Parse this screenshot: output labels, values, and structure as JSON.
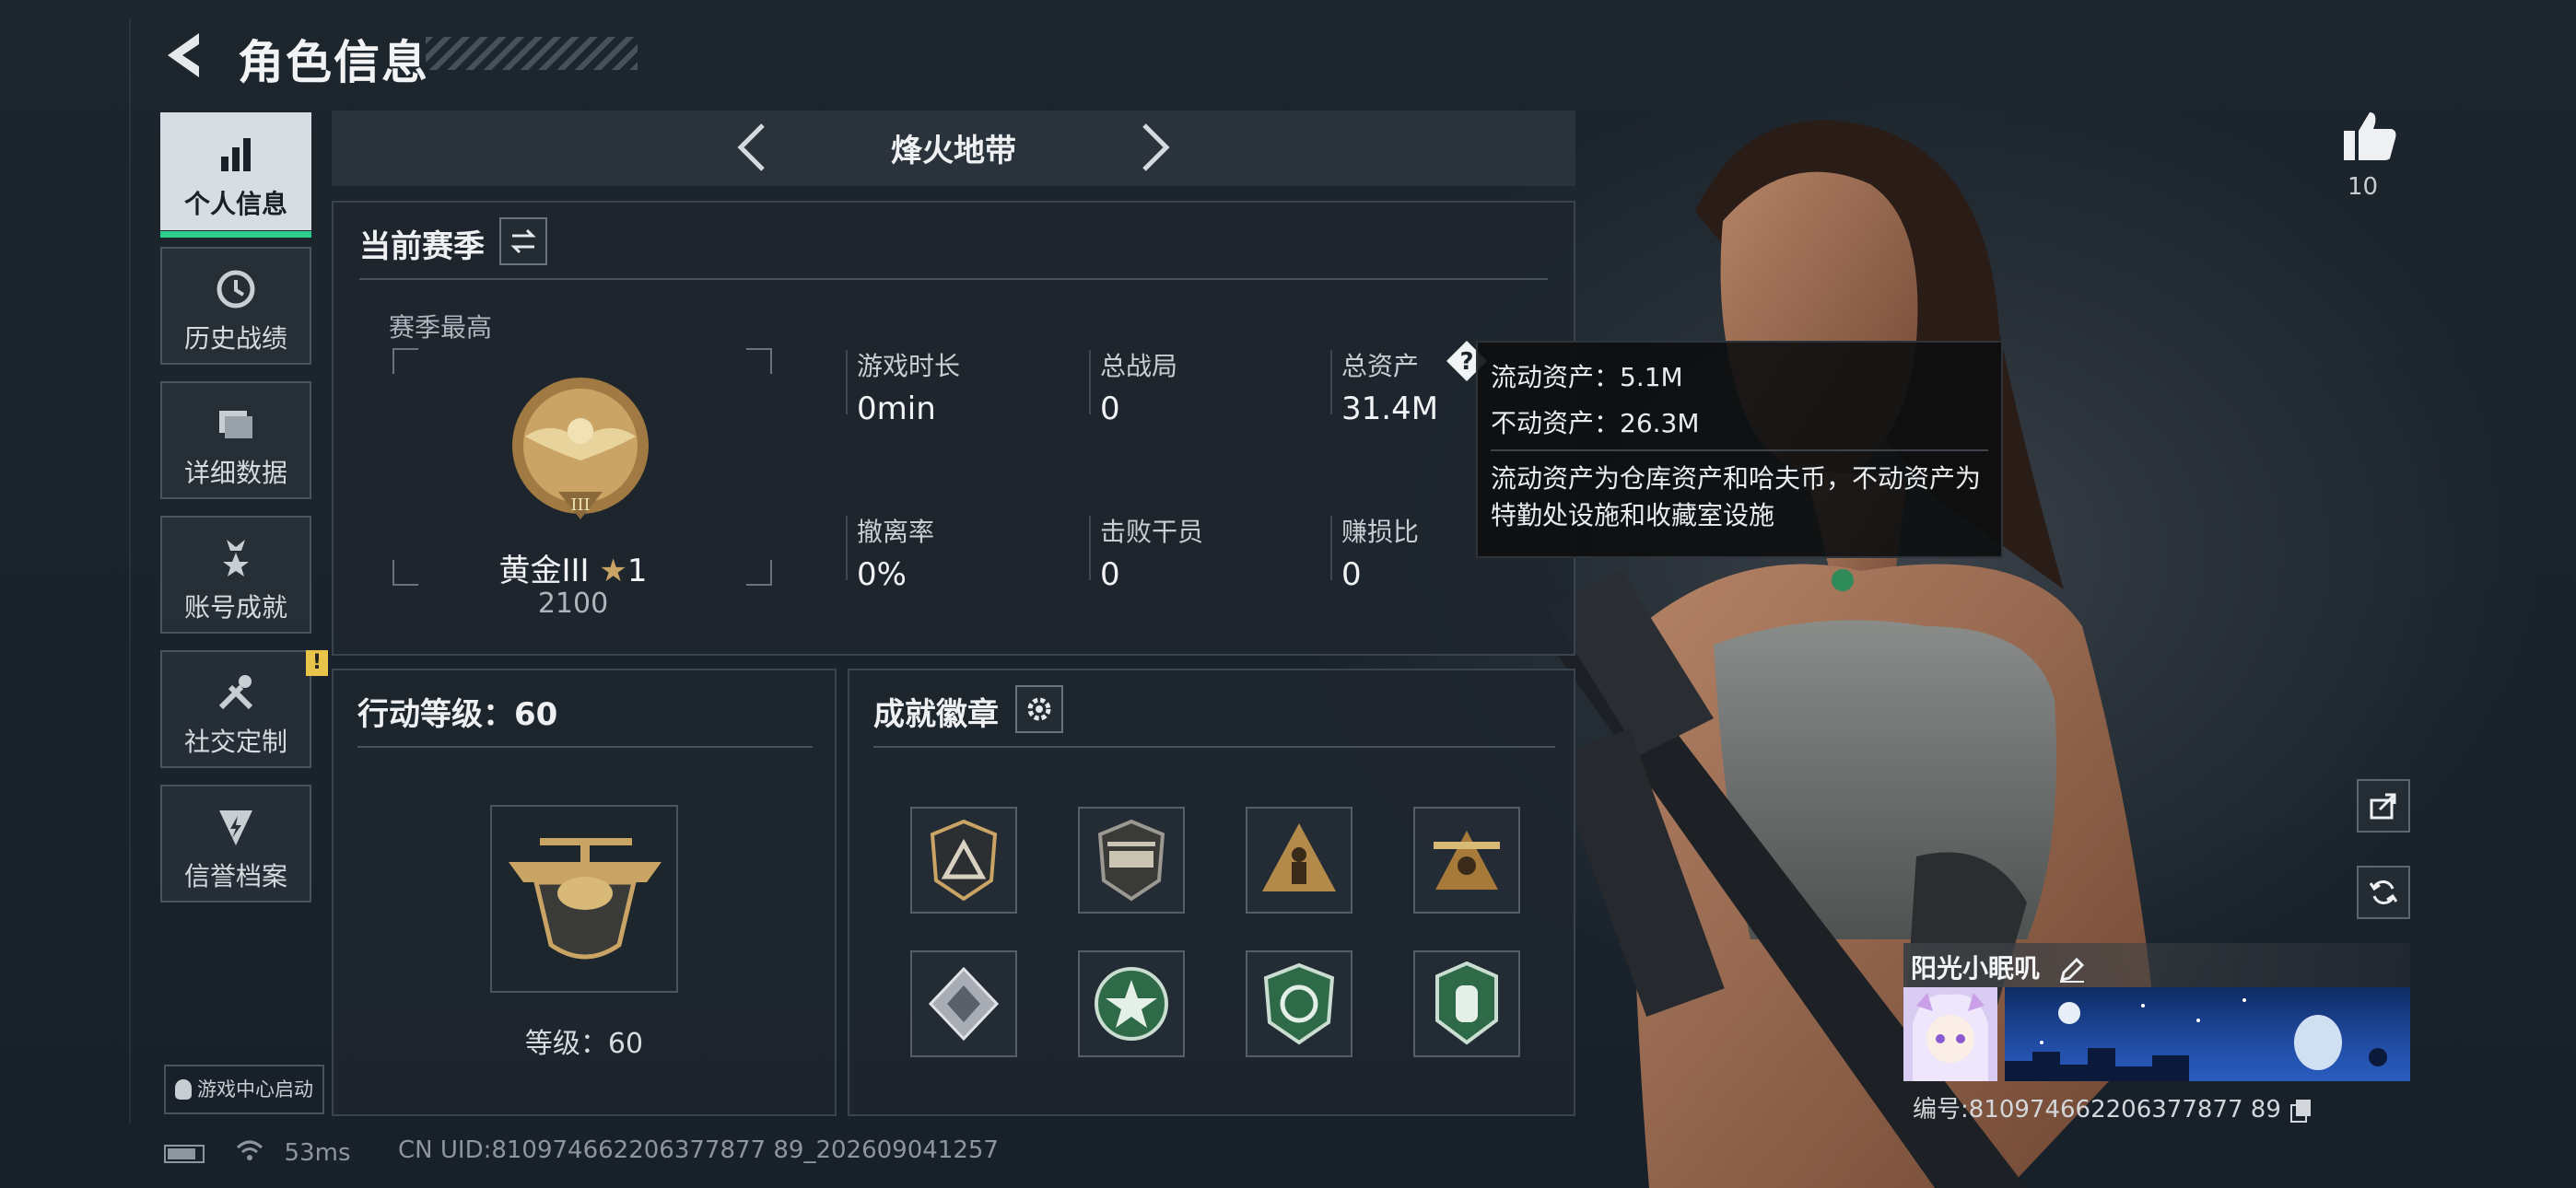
{
  "header": {
    "title": "角色信息"
  },
  "nav": [
    {
      "label": "个人信息",
      "icon": "bar-chart-icon",
      "active": true
    },
    {
      "label": "历史战绩",
      "icon": "history-clock-icon"
    },
    {
      "label": "详细数据",
      "icon": "folder-icon"
    },
    {
      "label": "账号成就",
      "icon": "medal-icon"
    },
    {
      "label": "社交定制",
      "icon": "tools-icon",
      "badge": "!"
    },
    {
      "label": "信誉档案",
      "icon": "shield-bolt-icon"
    }
  ],
  "game_center": {
    "label": "游戏中心启动"
  },
  "mode": {
    "name": "烽火地带"
  },
  "season": {
    "title": "当前赛季",
    "best_label": "赛季最高",
    "rank_name": "黄金III",
    "rank_stars": "1",
    "rank_points": "2100",
    "stats": [
      {
        "label": "游戏时长",
        "value": "0min"
      },
      {
        "label": "总战局",
        "value": "0"
      },
      {
        "label": "总资产",
        "value": "31.4M"
      },
      {
        "label": "撤离率",
        "value": "0%"
      },
      {
        "label": "击败干员",
        "value": "0"
      },
      {
        "label": "赚损比",
        "value": "0"
      }
    ]
  },
  "tooltip": {
    "liquid": "流动资产：5.1M",
    "fixed": "不动资产：26.3M",
    "desc": "流动资产为仓库资产和哈夫币，不动资产为特勤处设施和收藏室设施"
  },
  "action_level": {
    "title": "行动等级：60",
    "level_text": "等级：60"
  },
  "badges": {
    "title": "成就徽章"
  },
  "status": {
    "ping": "53ms",
    "uid": "CN UID:810974662206377877 89_202609041257"
  },
  "like": {
    "count": "10"
  },
  "player": {
    "name": "阳光小眠叽",
    "id": "编号:810974662206377877 89"
  },
  "colors": {
    "accent": "#2ecf8c",
    "warn": "#e8c44a",
    "gold": "#c9a464"
  }
}
